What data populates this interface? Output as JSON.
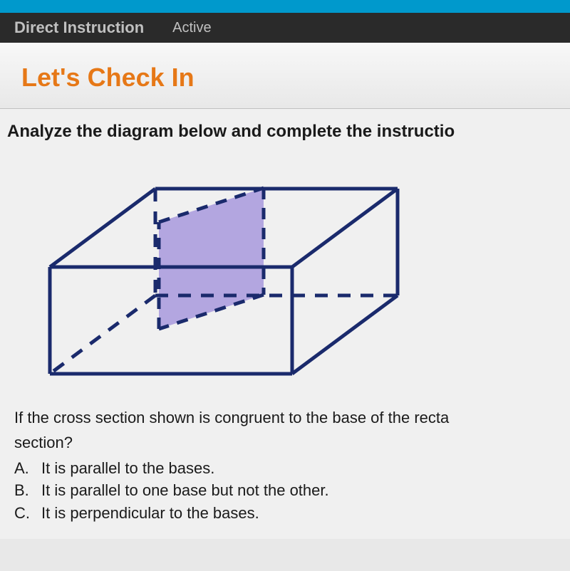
{
  "nav": {
    "primary": "Direct Instruction",
    "secondary": "Active"
  },
  "header": {
    "title": "Let's Check In"
  },
  "question": {
    "instruction": "Analyze the diagram below and complete the instructio",
    "prompt_line1": "If the cross section shown is congruent to the base of the recta",
    "prompt_line2": "section?",
    "options": [
      {
        "letter": "A.",
        "text": "It is parallel to the bases."
      },
      {
        "letter": "B.",
        "text": "It is parallel to one base but not the other."
      },
      {
        "letter": "C.",
        "text": "It is perpendicular to the bases."
      }
    ]
  }
}
